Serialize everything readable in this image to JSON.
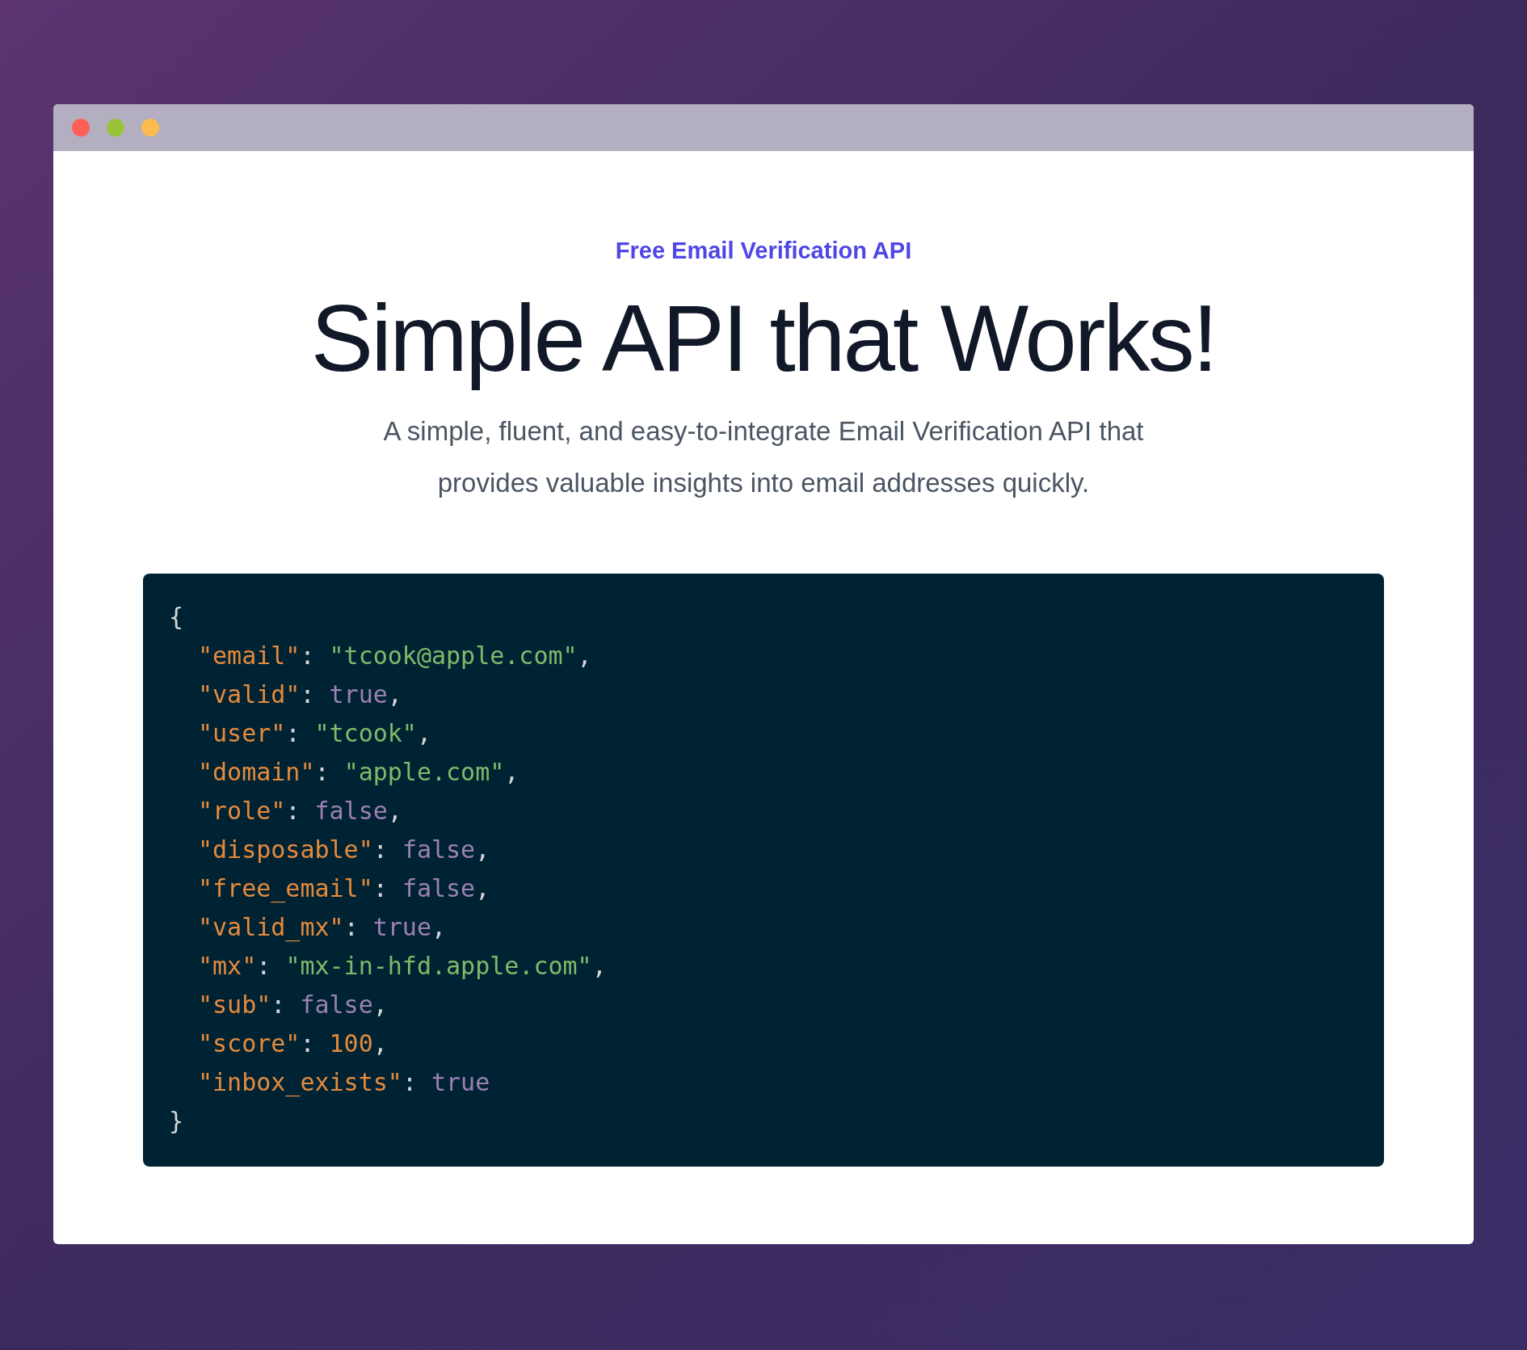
{
  "window": {
    "buttons": [
      {
        "color": "#ff5f57"
      },
      {
        "color": "#9bc33a"
      },
      {
        "color": "#febc4f"
      }
    ]
  },
  "eyebrow": "Free Email Verification API",
  "heading": "Simple API that Works!",
  "description": "A simple, fluent, and easy-to-integrate Email Verification API that provides valuable insights into email addresses quickly.",
  "code": {
    "open": "{",
    "close": "}",
    "children": [
      {
        "tokens": [
          {
            "kind": "key",
            "text": "\"email\""
          },
          {
            "kind": "punct",
            "text": ": "
          },
          {
            "kind": "string",
            "text": "\"tcook@apple.com\""
          },
          {
            "kind": "punct",
            "text": ","
          }
        ]
      },
      {
        "tokens": [
          {
            "kind": "key",
            "text": "\"valid\""
          },
          {
            "kind": "punct",
            "text": ": "
          },
          {
            "kind": "boolean",
            "text": "true"
          },
          {
            "kind": "punct",
            "text": ","
          }
        ]
      },
      {
        "tokens": [
          {
            "kind": "key",
            "text": "\"user\""
          },
          {
            "kind": "punct",
            "text": ": "
          },
          {
            "kind": "string",
            "text": "\"tcook\""
          },
          {
            "kind": "punct",
            "text": ","
          }
        ]
      },
      {
        "tokens": [
          {
            "kind": "key",
            "text": "\"domain\""
          },
          {
            "kind": "punct",
            "text": ": "
          },
          {
            "kind": "string",
            "text": "\"apple.com\""
          },
          {
            "kind": "punct",
            "text": ","
          }
        ]
      },
      {
        "tokens": [
          {
            "kind": "key",
            "text": "\"role\""
          },
          {
            "kind": "punct",
            "text": ": "
          },
          {
            "kind": "boolean",
            "text": "false"
          },
          {
            "kind": "punct",
            "text": ","
          }
        ]
      },
      {
        "tokens": [
          {
            "kind": "key",
            "text": "\"disposable\""
          },
          {
            "kind": "punct",
            "text": ": "
          },
          {
            "kind": "boolean",
            "text": "false"
          },
          {
            "kind": "punct",
            "text": ","
          }
        ]
      },
      {
        "tokens": [
          {
            "kind": "key",
            "text": "\"free_email\""
          },
          {
            "kind": "punct",
            "text": ": "
          },
          {
            "kind": "boolean",
            "text": "false"
          },
          {
            "kind": "punct",
            "text": ","
          }
        ]
      },
      {
        "tokens": [
          {
            "kind": "key",
            "text": "\"valid_mx\""
          },
          {
            "kind": "punct",
            "text": ": "
          },
          {
            "kind": "boolean",
            "text": "true"
          },
          {
            "kind": "punct",
            "text": ","
          }
        ]
      },
      {
        "tokens": [
          {
            "kind": "key",
            "text": "\"mx\""
          },
          {
            "kind": "punct",
            "text": ": "
          },
          {
            "kind": "string",
            "text": "\"mx-in-hfd.apple.com\""
          },
          {
            "kind": "punct",
            "text": ","
          }
        ]
      },
      {
        "tokens": [
          {
            "kind": "key",
            "text": "\"sub\""
          },
          {
            "kind": "punct",
            "text": ": "
          },
          {
            "kind": "boolean",
            "text": "false"
          },
          {
            "kind": "punct",
            "text": ","
          }
        ]
      },
      {
        "tokens": [
          {
            "kind": "key",
            "text": "\"score\""
          },
          {
            "kind": "punct",
            "text": ": "
          },
          {
            "kind": "number",
            "text": "100"
          },
          {
            "kind": "punct",
            "text": ","
          }
        ]
      },
      {
        "tokens": [
          {
            "kind": "key",
            "text": "\"inbox_exists\""
          },
          {
            "kind": "punct",
            "text": ": "
          },
          {
            "kind": "boolean",
            "text": "true"
          }
        ]
      }
    ]
  }
}
